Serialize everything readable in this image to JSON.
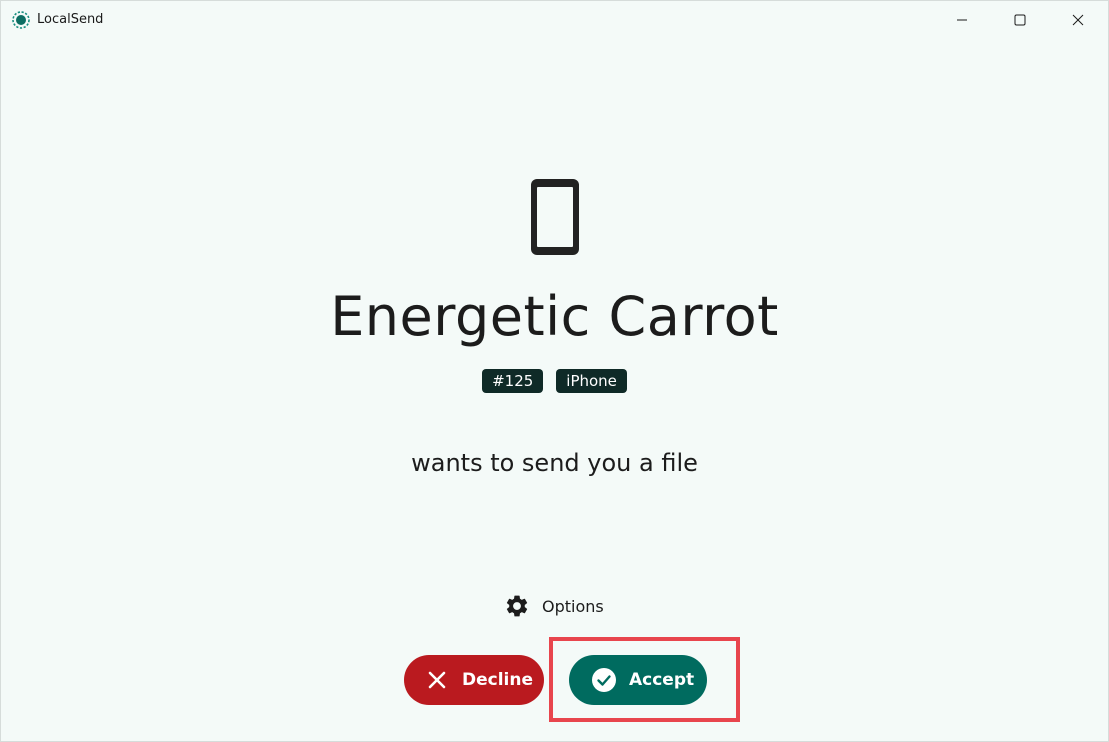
{
  "window": {
    "title": "LocalSend"
  },
  "request": {
    "device_icon": "phone-icon",
    "sender_name": "Energetic Carrot",
    "badges": [
      "#125",
      "iPhone"
    ],
    "message": "wants to send you a file"
  },
  "actions": {
    "options_label": "Options",
    "decline_label": "Decline",
    "accept_label": "Accept"
  },
  "colors": {
    "background": "#f4faf8",
    "badge": "#0f2a27",
    "decline": "#ba1a1f",
    "accept": "#006b5f",
    "highlight": "#e8454d"
  }
}
